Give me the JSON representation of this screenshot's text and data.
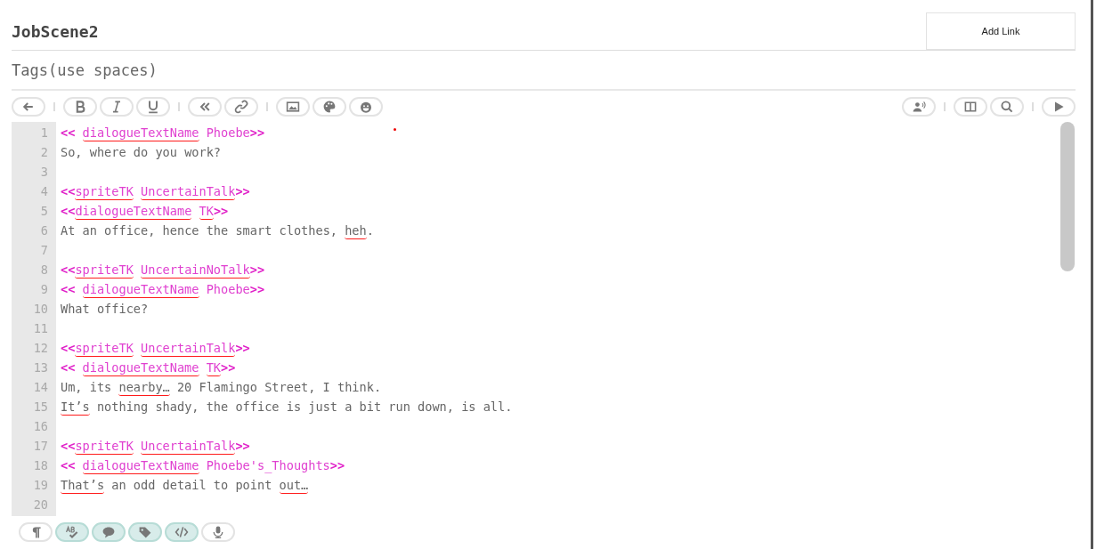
{
  "passage": {
    "title": "JobScene2",
    "tags_placeholder": "Tags(use spaces)",
    "add_link": "Add Link"
  },
  "editor_lines": [
    {
      "number": "1",
      "tokens": [
        {
          "kind": "mark",
          "text": "<<",
          "misspelled": false,
          "space_before": false
        },
        {
          "kind": "cmd",
          "text": "dialogueTextName",
          "misspelled": true,
          "space_before": true
        },
        {
          "kind": "cmd",
          "text": "Phoebe",
          "misspelled": false,
          "space_before": true
        },
        {
          "kind": "mark",
          "text": ">>",
          "misspelled": false,
          "space_before": false
        }
      ]
    },
    {
      "number": "2",
      "tokens": [
        {
          "kind": "text",
          "text": "So, where do you work?",
          "misspelled": false,
          "space_before": false
        }
      ]
    },
    {
      "number": "3"
    },
    {
      "number": "4",
      "tokens": [
        {
          "kind": "mark",
          "text": "<<",
          "misspelled": false,
          "space_before": false
        },
        {
          "kind": "cmd",
          "text": "spriteTK",
          "misspelled": true,
          "space_before": false
        },
        {
          "kind": "cmd",
          "text": "UncertainTalk",
          "misspelled": true,
          "space_before": true
        },
        {
          "kind": "mark",
          "text": ">>",
          "misspelled": false,
          "space_before": false
        }
      ]
    },
    {
      "number": "5",
      "tokens": [
        {
          "kind": "mark",
          "text": "<<",
          "misspelled": false,
          "space_before": false
        },
        {
          "kind": "cmd",
          "text": "dialogueTextName",
          "misspelled": true,
          "space_before": false
        },
        {
          "kind": "cmd",
          "text": "TK",
          "misspelled": true,
          "space_before": true
        },
        {
          "kind": "mark",
          "text": ">>",
          "misspelled": false,
          "space_before": false
        }
      ]
    },
    {
      "number": "6",
      "tokens": [
        {
          "kind": "text",
          "text": "At an office, hence the smart clothes,",
          "misspelled": false,
          "space_before": false
        },
        {
          "kind": "text",
          "text": "heh",
          "misspelled": true,
          "space_before": true
        },
        {
          "kind": "text",
          "text": ".",
          "misspelled": false,
          "space_before": false
        }
      ]
    },
    {
      "number": "7"
    },
    {
      "number": "8",
      "tokens": [
        {
          "kind": "mark",
          "text": "<<",
          "misspelled": false,
          "space_before": false
        },
        {
          "kind": "cmd",
          "text": "spriteTK",
          "misspelled": true,
          "space_before": false
        },
        {
          "kind": "cmd",
          "text": "UncertainNoTalk",
          "misspelled": true,
          "space_before": true
        },
        {
          "kind": "mark",
          "text": ">>",
          "misspelled": false,
          "space_before": false
        }
      ]
    },
    {
      "number": "9",
      "tokens": [
        {
          "kind": "mark",
          "text": "<<",
          "misspelled": false,
          "space_before": false
        },
        {
          "kind": "cmd",
          "text": "dialogueTextName",
          "misspelled": true,
          "space_before": true
        },
        {
          "kind": "cmd",
          "text": "Phoebe",
          "misspelled": false,
          "space_before": true
        },
        {
          "kind": "mark",
          "text": ">>",
          "misspelled": false,
          "space_before": false
        }
      ]
    },
    {
      "number": "10",
      "tokens": [
        {
          "kind": "text",
          "text": "What office?",
          "misspelled": false,
          "space_before": false
        }
      ]
    },
    {
      "number": "11"
    },
    {
      "number": "12",
      "tokens": [
        {
          "kind": "mark",
          "text": "<<",
          "misspelled": false,
          "space_before": false
        },
        {
          "kind": "cmd",
          "text": "spriteTK",
          "misspelled": true,
          "space_before": false
        },
        {
          "kind": "cmd",
          "text": "UncertainTalk",
          "misspelled": true,
          "space_before": true
        },
        {
          "kind": "mark",
          "text": ">>",
          "misspelled": false,
          "space_before": false
        }
      ]
    },
    {
      "number": "13",
      "tokens": [
        {
          "kind": "mark",
          "text": "<<",
          "misspelled": false,
          "space_before": false
        },
        {
          "kind": "cmd",
          "text": "dialogueTextName",
          "misspelled": true,
          "space_before": true
        },
        {
          "kind": "cmd",
          "text": "TK",
          "misspelled": true,
          "space_before": true
        },
        {
          "kind": "mark",
          "text": ">>",
          "misspelled": false,
          "space_before": false
        }
      ]
    },
    {
      "number": "14",
      "tokens": [
        {
          "kind": "text",
          "text": "Um, its",
          "misspelled": false,
          "space_before": false
        },
        {
          "kind": "text",
          "text": "nearby…",
          "misspelled": true,
          "space_before": true
        },
        {
          "kind": "text",
          "text": "20 Flamingo Street, I think.",
          "misspelled": false,
          "space_before": true
        }
      ]
    },
    {
      "number": "15",
      "tokens": [
        {
          "kind": "text",
          "text": "It’s",
          "misspelled": true,
          "space_before": false
        },
        {
          "kind": "text",
          "text": "nothing shady, the office is just a bit run down, is all.",
          "misspelled": false,
          "space_before": true
        }
      ]
    },
    {
      "number": "16"
    },
    {
      "number": "17",
      "tokens": [
        {
          "kind": "mark",
          "text": "<<",
          "misspelled": false,
          "space_before": false
        },
        {
          "kind": "cmd",
          "text": "spriteTK",
          "misspelled": true,
          "space_before": false
        },
        {
          "kind": "cmd",
          "text": "UncertainTalk",
          "misspelled": true,
          "space_before": true
        },
        {
          "kind": "mark",
          "text": ">>",
          "misspelled": false,
          "space_before": false
        }
      ]
    },
    {
      "number": "18",
      "tokens": [
        {
          "kind": "mark",
          "text": "<<",
          "misspelled": false,
          "space_before": false
        },
        {
          "kind": "cmd",
          "text": "dialogueTextName",
          "misspelled": true,
          "space_before": true
        },
        {
          "kind": "cmd",
          "text": "Phoebe's_Thoughts",
          "misspelled": false,
          "space_before": true
        },
        {
          "kind": "mark",
          "text": ">>",
          "misspelled": false,
          "space_before": false
        }
      ]
    },
    {
      "number": "19",
      "tokens": [
        {
          "kind": "text",
          "text": "That’s",
          "misspelled": true,
          "space_before": false
        },
        {
          "kind": "text",
          "text": "an odd detail to point",
          "misspelled": false,
          "space_before": true
        },
        {
          "kind": "text",
          "text": "out…",
          "misspelled": true,
          "space_before": true
        }
      ]
    },
    {
      "number": "20"
    }
  ],
  "bottom_toolbar": [
    {
      "on": false
    },
    {
      "on": true
    },
    {
      "on": true
    },
    {
      "on": true
    },
    {
      "on": true
    },
    {
      "on": false
    }
  ]
}
